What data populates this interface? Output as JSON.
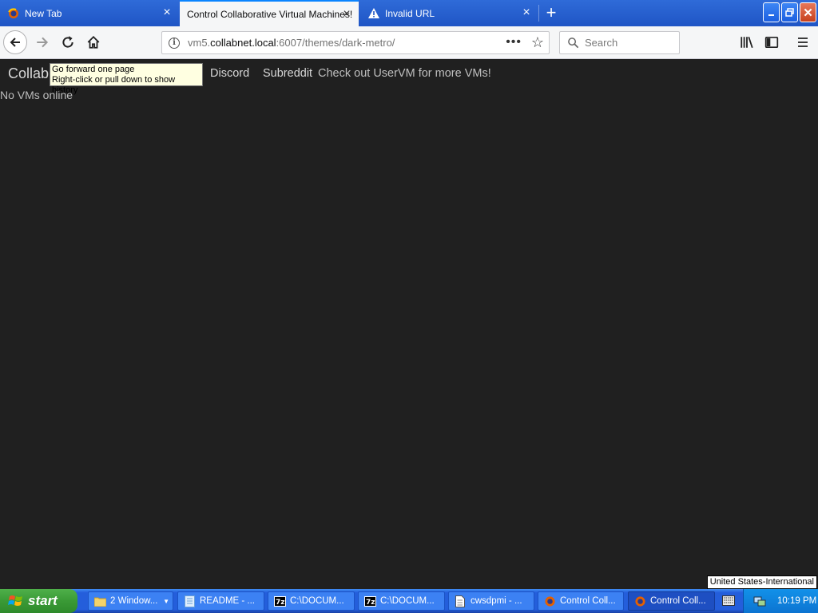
{
  "browser": {
    "tabs": [
      {
        "title": "New Tab",
        "active": false
      },
      {
        "title": "Control Collaborative Virtual Machines!",
        "active": true
      },
      {
        "title": "Invalid URL",
        "active": false
      }
    ],
    "url": {
      "prefix": "vm5.",
      "host": "collabnet.local",
      "rest": ":6007/themes/dark-metro/"
    },
    "search_placeholder": "Search"
  },
  "page": {
    "brand": "Collab",
    "nav_links": [
      "Discord",
      "Subreddit"
    ],
    "promo": "Check out UserVM for more VMs!",
    "status": "No VMs online"
  },
  "tooltip": {
    "line1": "Go forward one page",
    "line2": "Right-click or pull down to show history"
  },
  "taskbar": {
    "start_label": "start",
    "items": [
      {
        "label": "2 Window...",
        "icon": "folder-icon"
      },
      {
        "label": "README - ...",
        "icon": "notepad-icon"
      },
      {
        "label": "C:\\DOCUM...",
        "icon": "7zip-icon"
      },
      {
        "label": "C:\\DOCUM...",
        "icon": "7zip-icon"
      },
      {
        "label": "cwsdpmi - ...",
        "icon": "document-icon"
      },
      {
        "label": "Control Coll...",
        "icon": "firefox-icon"
      },
      {
        "label": "Control Coll...",
        "icon": "firefox-icon"
      }
    ],
    "language": "United States-International",
    "clock": "10:19 PM"
  },
  "colors": {
    "page_bg": "#202020",
    "tabstrip": "#1f55c5",
    "taskbar": "#245edb",
    "start_green": "#3a9a36",
    "tooltip_bg": "#ffffe1"
  }
}
